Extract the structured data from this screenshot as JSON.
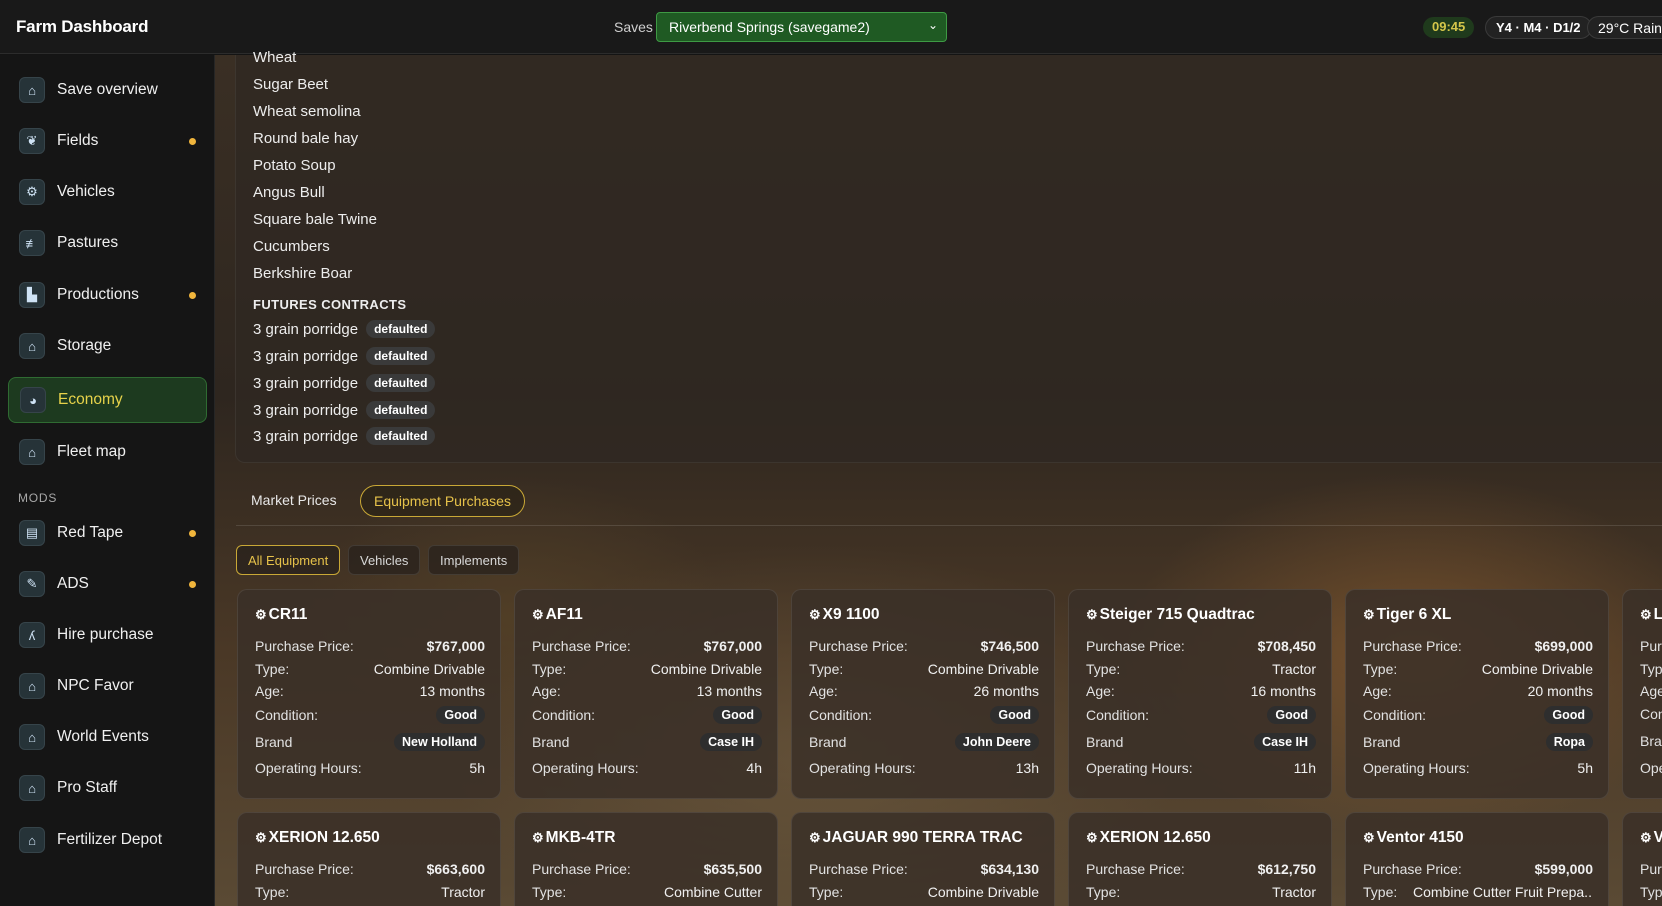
{
  "app": {
    "title": "Farm Dashboard"
  },
  "topbar": {
    "saves_label": "Saves",
    "save_selected": "Riverbend Springs (savegame2)",
    "clock": "09:45",
    "date": "Y4 · M4 · D1/2",
    "weather": "29°C Rain"
  },
  "sidebar": {
    "items": [
      {
        "label": "Save overview",
        "icon": "home-icon",
        "dot": false
      },
      {
        "label": "Fields",
        "icon": "field-icon",
        "dot": true
      },
      {
        "label": "Vehicles",
        "icon": "tractor-icon",
        "dot": false
      },
      {
        "label": "Pastures",
        "icon": "fence-icon",
        "dot": false
      },
      {
        "label": "Productions",
        "icon": "factory-icon",
        "dot": true
      },
      {
        "label": "Storage",
        "icon": "storage-icon",
        "dot": false
      },
      {
        "label": "Economy",
        "icon": "economy-icon",
        "dot": false,
        "active": true
      },
      {
        "label": "Fleet map",
        "icon": "map-icon",
        "dot": false
      }
    ],
    "mods_header": "MODS",
    "mods": [
      {
        "label": "Red Tape",
        "icon": "clipboard-icon",
        "dot": true
      },
      {
        "label": "ADS",
        "icon": "wrench-icon",
        "dot": true
      },
      {
        "label": "Hire purchase",
        "icon": "handshake-icon",
        "dot": false
      },
      {
        "label": "NPC Favor",
        "icon": "home-icon",
        "dot": false
      },
      {
        "label": "World Events",
        "icon": "home-icon",
        "dot": false
      },
      {
        "label": "Pro Staff",
        "icon": "home-icon",
        "dot": false
      },
      {
        "label": "Fertilizer Depot",
        "icon": "home-icon",
        "dot": false
      }
    ]
  },
  "top_list": [
    "Wheat",
    "Sugar Beet",
    "Wheat semolina",
    "Round bale hay",
    "Potato Soup",
    "Angus Bull",
    "Square bale Twine",
    "Cucumbers",
    "Berkshire Boar"
  ],
  "futures": {
    "title": "FUTURES CONTRACTS",
    "rows": [
      {
        "name": "3 grain porridge",
        "status": "defaulted"
      },
      {
        "name": "3 grain porridge",
        "status": "defaulted"
      },
      {
        "name": "3 grain porridge",
        "status": "defaulted"
      },
      {
        "name": "3 grain porridge",
        "status": "defaulted"
      },
      {
        "name": "3 grain porridge",
        "status": "defaulted"
      }
    ]
  },
  "tabs": [
    "Market Prices",
    "Equipment Purchases"
  ],
  "filters": [
    "All Equipment",
    "Vehicles",
    "Implements"
  ],
  "labels": {
    "price": "Purchase Price:",
    "type": "Type:",
    "age": "Age:",
    "condition": "Condition:",
    "brand": "Brand",
    "hours": "Operating Hours:",
    "price_short": "Purc",
    "type_short": "Typ",
    "age_short": "Age",
    "condition_short": "Con",
    "brand_short": "Bra",
    "hours_short": "Ope"
  },
  "cards_row1": [
    {
      "name": "CR11",
      "price": "$767,000",
      "type": "Combine Drivable",
      "age": "13 months",
      "condition": "Good",
      "brand": "New Holland",
      "hours": "5h"
    },
    {
      "name": "AF11",
      "price": "$767,000",
      "type": "Combine Drivable",
      "age": "13 months",
      "condition": "Good",
      "brand": "Case IH",
      "hours": "4h"
    },
    {
      "name": "X9 1100",
      "price": "$746,500",
      "type": "Combine Drivable",
      "age": "26 months",
      "condition": "Good",
      "brand": "John Deere",
      "hours": "13h"
    },
    {
      "name": "Steiger 715 Quadtrac",
      "price": "$708,450",
      "type": "Tractor",
      "age": "16 months",
      "condition": "Good",
      "brand": "Case IH",
      "hours": "11h"
    },
    {
      "name": "Tiger 6 XL",
      "price": "$699,000",
      "type": "Combine Drivable",
      "age": "20 months",
      "condition": "Good",
      "brand": "Ropa",
      "hours": "5h"
    },
    {
      "name": "L"
    }
  ],
  "cards_row2": [
    {
      "name": "XERION 12.650",
      "price": "$663,600",
      "type": "Tractor"
    },
    {
      "name": "MKB-4TR",
      "price": "$635,500",
      "type": "Combine Cutter"
    },
    {
      "name": "JAGUAR 990 TERRA TRAC",
      "price": "$634,130",
      "type": "Combine Drivable"
    },
    {
      "name": "XERION 12.650",
      "price": "$612,750",
      "type": "Tractor"
    },
    {
      "name": "Ventor 4150",
      "price": "$599,000",
      "type": "Combine Cutter Fruit Prepa..."
    },
    {
      "name": "V"
    }
  ]
}
